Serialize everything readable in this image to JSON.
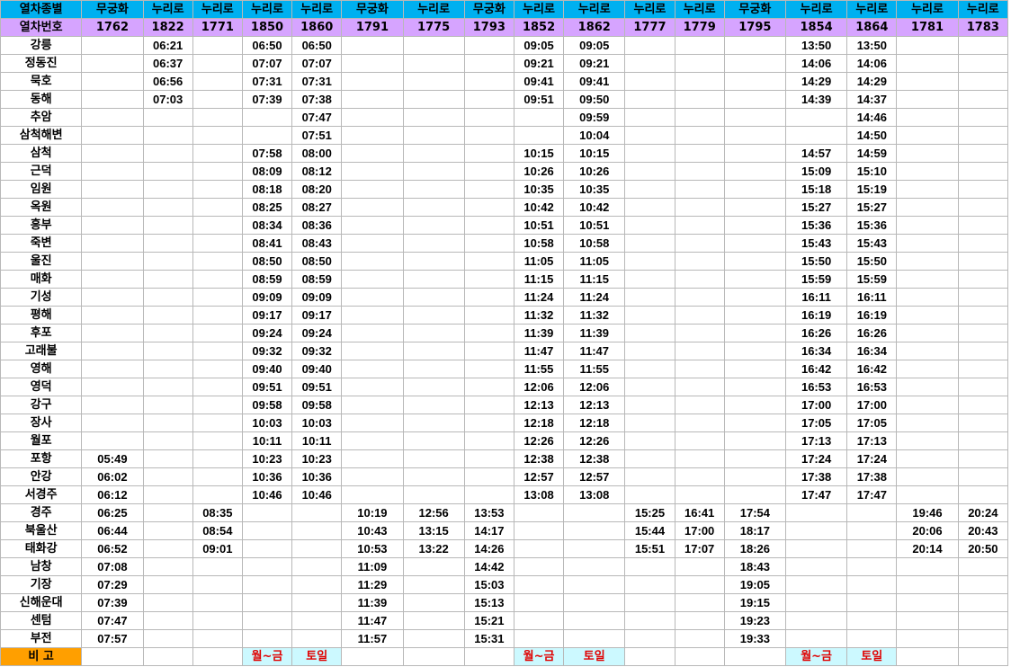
{
  "header": {
    "type_label": "열차종별",
    "number_label": "열차번호",
    "note_label": "비 고"
  },
  "trains": [
    {
      "type": "무궁화",
      "number": "1762",
      "note": ""
    },
    {
      "type": "누리로",
      "number": "1822",
      "note": ""
    },
    {
      "type": "누리로",
      "number": "1771",
      "note": ""
    },
    {
      "type": "누리로",
      "number": "1850",
      "note": "월~금"
    },
    {
      "type": "누리로",
      "number": "1860",
      "note": "토일"
    },
    {
      "type": "무궁화",
      "number": "1791",
      "note": ""
    },
    {
      "type": "누리로",
      "number": "1775",
      "note": ""
    },
    {
      "type": "무궁화",
      "number": "1793",
      "note": ""
    },
    {
      "type": "누리로",
      "number": "1852",
      "note": "월~금"
    },
    {
      "type": "누리로",
      "number": "1862",
      "note": "토일"
    },
    {
      "type": "누리로",
      "number": "1777",
      "note": ""
    },
    {
      "type": "누리로",
      "number": "1779",
      "note": ""
    },
    {
      "type": "무궁화",
      "number": "1795",
      "note": ""
    },
    {
      "type": "누리로",
      "number": "1854",
      "note": "월~금"
    },
    {
      "type": "누리로",
      "number": "1864",
      "note": "토일"
    },
    {
      "type": "누리로",
      "number": "1781",
      "note": ""
    },
    {
      "type": "누리로",
      "number": "1783",
      "note": ""
    }
  ],
  "rows": [
    {
      "station": "강릉",
      "times": [
        "",
        "06:21",
        "",
        "06:50",
        "06:50",
        "",
        "",
        "",
        "09:05",
        "09:05",
        "",
        "",
        "",
        "13:50",
        "13:50",
        "",
        ""
      ]
    },
    {
      "station": "정동진",
      "times": [
        "",
        "06:37",
        "",
        "07:07",
        "07:07",
        "",
        "",
        "",
        "09:21",
        "09:21",
        "",
        "",
        "",
        "14:06",
        "14:06",
        "",
        ""
      ]
    },
    {
      "station": "묵호",
      "times": [
        "",
        "06:56",
        "",
        "07:31",
        "07:31",
        "",
        "",
        "",
        "09:41",
        "09:41",
        "",
        "",
        "",
        "14:29",
        "14:29",
        "",
        ""
      ]
    },
    {
      "station": "동해",
      "times": [
        "",
        "07:03",
        "",
        "07:39",
        "07:38",
        "",
        "",
        "",
        "09:51",
        "09:50",
        "",
        "",
        "",
        "14:39",
        "14:37",
        "",
        ""
      ]
    },
    {
      "station": "추암",
      "times": [
        "",
        "",
        "",
        "",
        "07:47",
        "",
        "",
        "",
        "",
        "09:59",
        "",
        "",
        "",
        "",
        "14:46",
        "",
        ""
      ]
    },
    {
      "station": "삼척해변",
      "times": [
        "",
        "",
        "",
        "",
        "07:51",
        "",
        "",
        "",
        "",
        "10:04",
        "",
        "",
        "",
        "",
        "14:50",
        "",
        ""
      ]
    },
    {
      "station": "삼척",
      "times": [
        "",
        "",
        "",
        "07:58",
        "08:00",
        "",
        "",
        "",
        "10:15",
        "10:15",
        "",
        "",
        "",
        "14:57",
        "14:59",
        "",
        ""
      ]
    },
    {
      "station": "근덕",
      "times": [
        "",
        "",
        "",
        "08:09",
        "08:12",
        "",
        "",
        "",
        "10:26",
        "10:26",
        "",
        "",
        "",
        "15:09",
        "15:10",
        "",
        ""
      ]
    },
    {
      "station": "임원",
      "times": [
        "",
        "",
        "",
        "08:18",
        "08:20",
        "",
        "",
        "",
        "10:35",
        "10:35",
        "",
        "",
        "",
        "15:18",
        "15:19",
        "",
        ""
      ]
    },
    {
      "station": "옥원",
      "times": [
        "",
        "",
        "",
        "08:25",
        "08:27",
        "",
        "",
        "",
        "10:42",
        "10:42",
        "",
        "",
        "",
        "15:27",
        "15:27",
        "",
        ""
      ]
    },
    {
      "station": "흥부",
      "times": [
        "",
        "",
        "",
        "08:34",
        "08:36",
        "",
        "",
        "",
        "10:51",
        "10:51",
        "",
        "",
        "",
        "15:36",
        "15:36",
        "",
        ""
      ]
    },
    {
      "station": "죽변",
      "times": [
        "",
        "",
        "",
        "08:41",
        "08:43",
        "",
        "",
        "",
        "10:58",
        "10:58",
        "",
        "",
        "",
        "15:43",
        "15:43",
        "",
        ""
      ]
    },
    {
      "station": "울진",
      "times": [
        "",
        "",
        "",
        "08:50",
        "08:50",
        "",
        "",
        "",
        "11:05",
        "11:05",
        "",
        "",
        "",
        "15:50",
        "15:50",
        "",
        ""
      ]
    },
    {
      "station": "매화",
      "times": [
        "",
        "",
        "",
        "08:59",
        "08:59",
        "",
        "",
        "",
        "11:15",
        "11:15",
        "",
        "",
        "",
        "15:59",
        "15:59",
        "",
        ""
      ]
    },
    {
      "station": "기성",
      "times": [
        "",
        "",
        "",
        "09:09",
        "09:09",
        "",
        "",
        "",
        "11:24",
        "11:24",
        "",
        "",
        "",
        "16:11",
        "16:11",
        "",
        ""
      ]
    },
    {
      "station": "평해",
      "times": [
        "",
        "",
        "",
        "09:17",
        "09:17",
        "",
        "",
        "",
        "11:32",
        "11:32",
        "",
        "",
        "",
        "16:19",
        "16:19",
        "",
        ""
      ]
    },
    {
      "station": "후포",
      "times": [
        "",
        "",
        "",
        "09:24",
        "09:24",
        "",
        "",
        "",
        "11:39",
        "11:39",
        "",
        "",
        "",
        "16:26",
        "16:26",
        "",
        ""
      ]
    },
    {
      "station": "고래불",
      "times": [
        "",
        "",
        "",
        "09:32",
        "09:32",
        "",
        "",
        "",
        "11:47",
        "11:47",
        "",
        "",
        "",
        "16:34",
        "16:34",
        "",
        ""
      ]
    },
    {
      "station": "영해",
      "times": [
        "",
        "",
        "",
        "09:40",
        "09:40",
        "",
        "",
        "",
        "11:55",
        "11:55",
        "",
        "",
        "",
        "16:42",
        "16:42",
        "",
        ""
      ]
    },
    {
      "station": "영덕",
      "times": [
        "",
        "",
        "",
        "09:51",
        "09:51",
        "",
        "",
        "",
        "12:06",
        "12:06",
        "",
        "",
        "",
        "16:53",
        "16:53",
        "",
        ""
      ]
    },
    {
      "station": "강구",
      "times": [
        "",
        "",
        "",
        "09:58",
        "09:58",
        "",
        "",
        "",
        "12:13",
        "12:13",
        "",
        "",
        "",
        "17:00",
        "17:00",
        "",
        ""
      ]
    },
    {
      "station": "장사",
      "times": [
        "",
        "",
        "",
        "10:03",
        "10:03",
        "",
        "",
        "",
        "12:18",
        "12:18",
        "",
        "",
        "",
        "17:05",
        "17:05",
        "",
        ""
      ]
    },
    {
      "station": "월포",
      "times": [
        "",
        "",
        "",
        "10:11",
        "10:11",
        "",
        "",
        "",
        "12:26",
        "12:26",
        "",
        "",
        "",
        "17:13",
        "17:13",
        "",
        ""
      ]
    },
    {
      "station": "포항",
      "times": [
        "05:49",
        "",
        "",
        "10:23",
        "10:23",
        "",
        "",
        "",
        "12:38",
        "12:38",
        "",
        "",
        "",
        "17:24",
        "17:24",
        "",
        ""
      ]
    },
    {
      "station": "안강",
      "times": [
        "06:02",
        "",
        "",
        "10:36",
        "10:36",
        "",
        "",
        "",
        "12:57",
        "12:57",
        "",
        "",
        "",
        "17:38",
        "17:38",
        "",
        ""
      ]
    },
    {
      "station": "서경주",
      "times": [
        "06:12",
        "",
        "",
        "10:46",
        "10:46",
        "",
        "",
        "",
        "13:08",
        "13:08",
        "",
        "",
        "",
        "17:47",
        "17:47",
        "",
        ""
      ]
    },
    {
      "station": "경주",
      "times": [
        "06:25",
        "",
        "08:35",
        "",
        "",
        "10:19",
        "12:56",
        "13:53",
        "",
        "",
        "15:25",
        "16:41",
        "17:54",
        "",
        "",
        "19:46",
        "20:24"
      ]
    },
    {
      "station": "북울산",
      "times": [
        "06:44",
        "",
        "08:54",
        "",
        "",
        "10:43",
        "13:15",
        "14:17",
        "",
        "",
        "15:44",
        "17:00",
        "18:17",
        "",
        "",
        "20:06",
        "20:43"
      ]
    },
    {
      "station": "태화강",
      "times": [
        "06:52",
        "",
        "09:01",
        "",
        "",
        "10:53",
        "13:22",
        "14:26",
        "",
        "",
        "15:51",
        "17:07",
        "18:26",
        "",
        "",
        "20:14",
        "20:50"
      ]
    },
    {
      "station": "남창",
      "times": [
        "07:08",
        "",
        "",
        "",
        "",
        "11:09",
        "",
        "14:42",
        "",
        "",
        "",
        "",
        "18:43",
        "",
        "",
        "",
        ""
      ]
    },
    {
      "station": "기장",
      "times": [
        "07:29",
        "",
        "",
        "",
        "",
        "11:29",
        "",
        "15:03",
        "",
        "",
        "",
        "",
        "19:05",
        "",
        "",
        "",
        ""
      ]
    },
    {
      "station": "신해운대",
      "times": [
        "07:39",
        "",
        "",
        "",
        "",
        "11:39",
        "",
        "15:13",
        "",
        "",
        "",
        "",
        "19:15",
        "",
        "",
        "",
        ""
      ]
    },
    {
      "station": "센텀",
      "times": [
        "07:47",
        "",
        "",
        "",
        "",
        "11:47",
        "",
        "15:21",
        "",
        "",
        "",
        "",
        "19:23",
        "",
        "",
        "",
        ""
      ]
    },
    {
      "station": "부전",
      "times": [
        "07:57",
        "",
        "",
        "",
        "",
        "11:57",
        "",
        "15:31",
        "",
        "",
        "",
        "",
        "19:33",
        "",
        "",
        "",
        ""
      ]
    }
  ],
  "colors": {
    "type_header_bg": "#00b0f0",
    "number_header_bg": "#d6a4ff",
    "note_label_bg": "#ff9f00",
    "note_highlight_bg": "#ccf9ff",
    "note_highlight_text": "#e00000"
  }
}
